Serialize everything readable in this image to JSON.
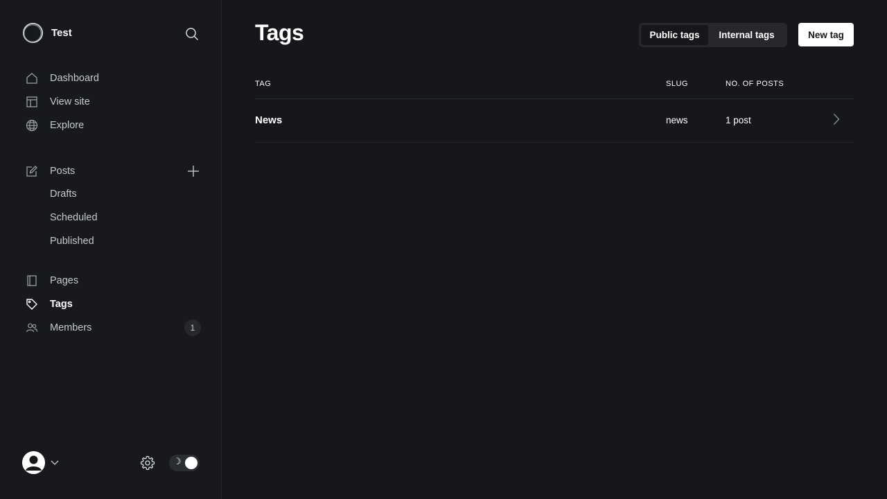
{
  "sidebar": {
    "site_name": "Test",
    "nav": [
      {
        "label": "Dashboard",
        "icon": "home-icon"
      },
      {
        "label": "View site",
        "icon": "layout-icon"
      },
      {
        "label": "Explore",
        "icon": "globe-icon"
      }
    ],
    "posts": {
      "label": "Posts",
      "icon": "edit-icon",
      "sub": [
        {
          "label": "Drafts"
        },
        {
          "label": "Scheduled"
        },
        {
          "label": "Published"
        }
      ]
    },
    "pages": {
      "label": "Pages",
      "icon": "page-icon"
    },
    "tags": {
      "label": "Tags",
      "icon": "tag-icon",
      "active": true
    },
    "members": {
      "label": "Members",
      "icon": "members-icon",
      "count": "1"
    }
  },
  "header": {
    "title": "Tags",
    "segment": {
      "public_label": "Public tags",
      "internal_label": "Internal tags",
      "selected": "Public tags"
    },
    "new_tag_label": "New tag"
  },
  "table": {
    "columns": [
      "TAG",
      "SLUG",
      "NO. OF POSTS"
    ],
    "rows": [
      {
        "name": "News",
        "slug": "news",
        "count": "1 post"
      }
    ]
  },
  "colors": {
    "background": "#15171a",
    "sidebar": "#18191c",
    "text": "#ffffff",
    "muted": "#c4c9ce",
    "accent": "#ffffff"
  }
}
